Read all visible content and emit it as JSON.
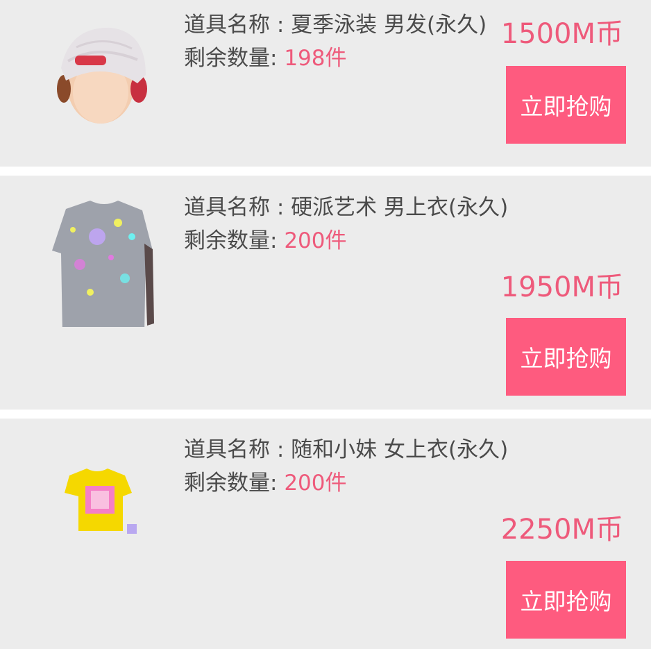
{
  "labels": {
    "name_label": "道具名称 : ",
    "stock_label": "剩余数量: "
  },
  "items": [
    {
      "name": "夏季泳装 男发(永久)",
      "stock": "198件",
      "price": "1500M币",
      "button": "立即抢购",
      "icon": "cap-hair-icon"
    },
    {
      "name": "硬派艺术 男上衣(永久)",
      "stock": "200件",
      "price": "1950M币",
      "button": "立即抢购",
      "icon": "paint-splatter-shirt-icon"
    },
    {
      "name": "随和小妹 女上衣(永久)",
      "stock": "200件",
      "price": "2250M币",
      "button": "立即抢购",
      "icon": "yellow-tshirt-icon"
    }
  ],
  "colors": {
    "card_bg": "#ececec",
    "accent": "#ee5a7b",
    "button_bg": "#fe5b7f",
    "text": "#4a4a4a"
  }
}
